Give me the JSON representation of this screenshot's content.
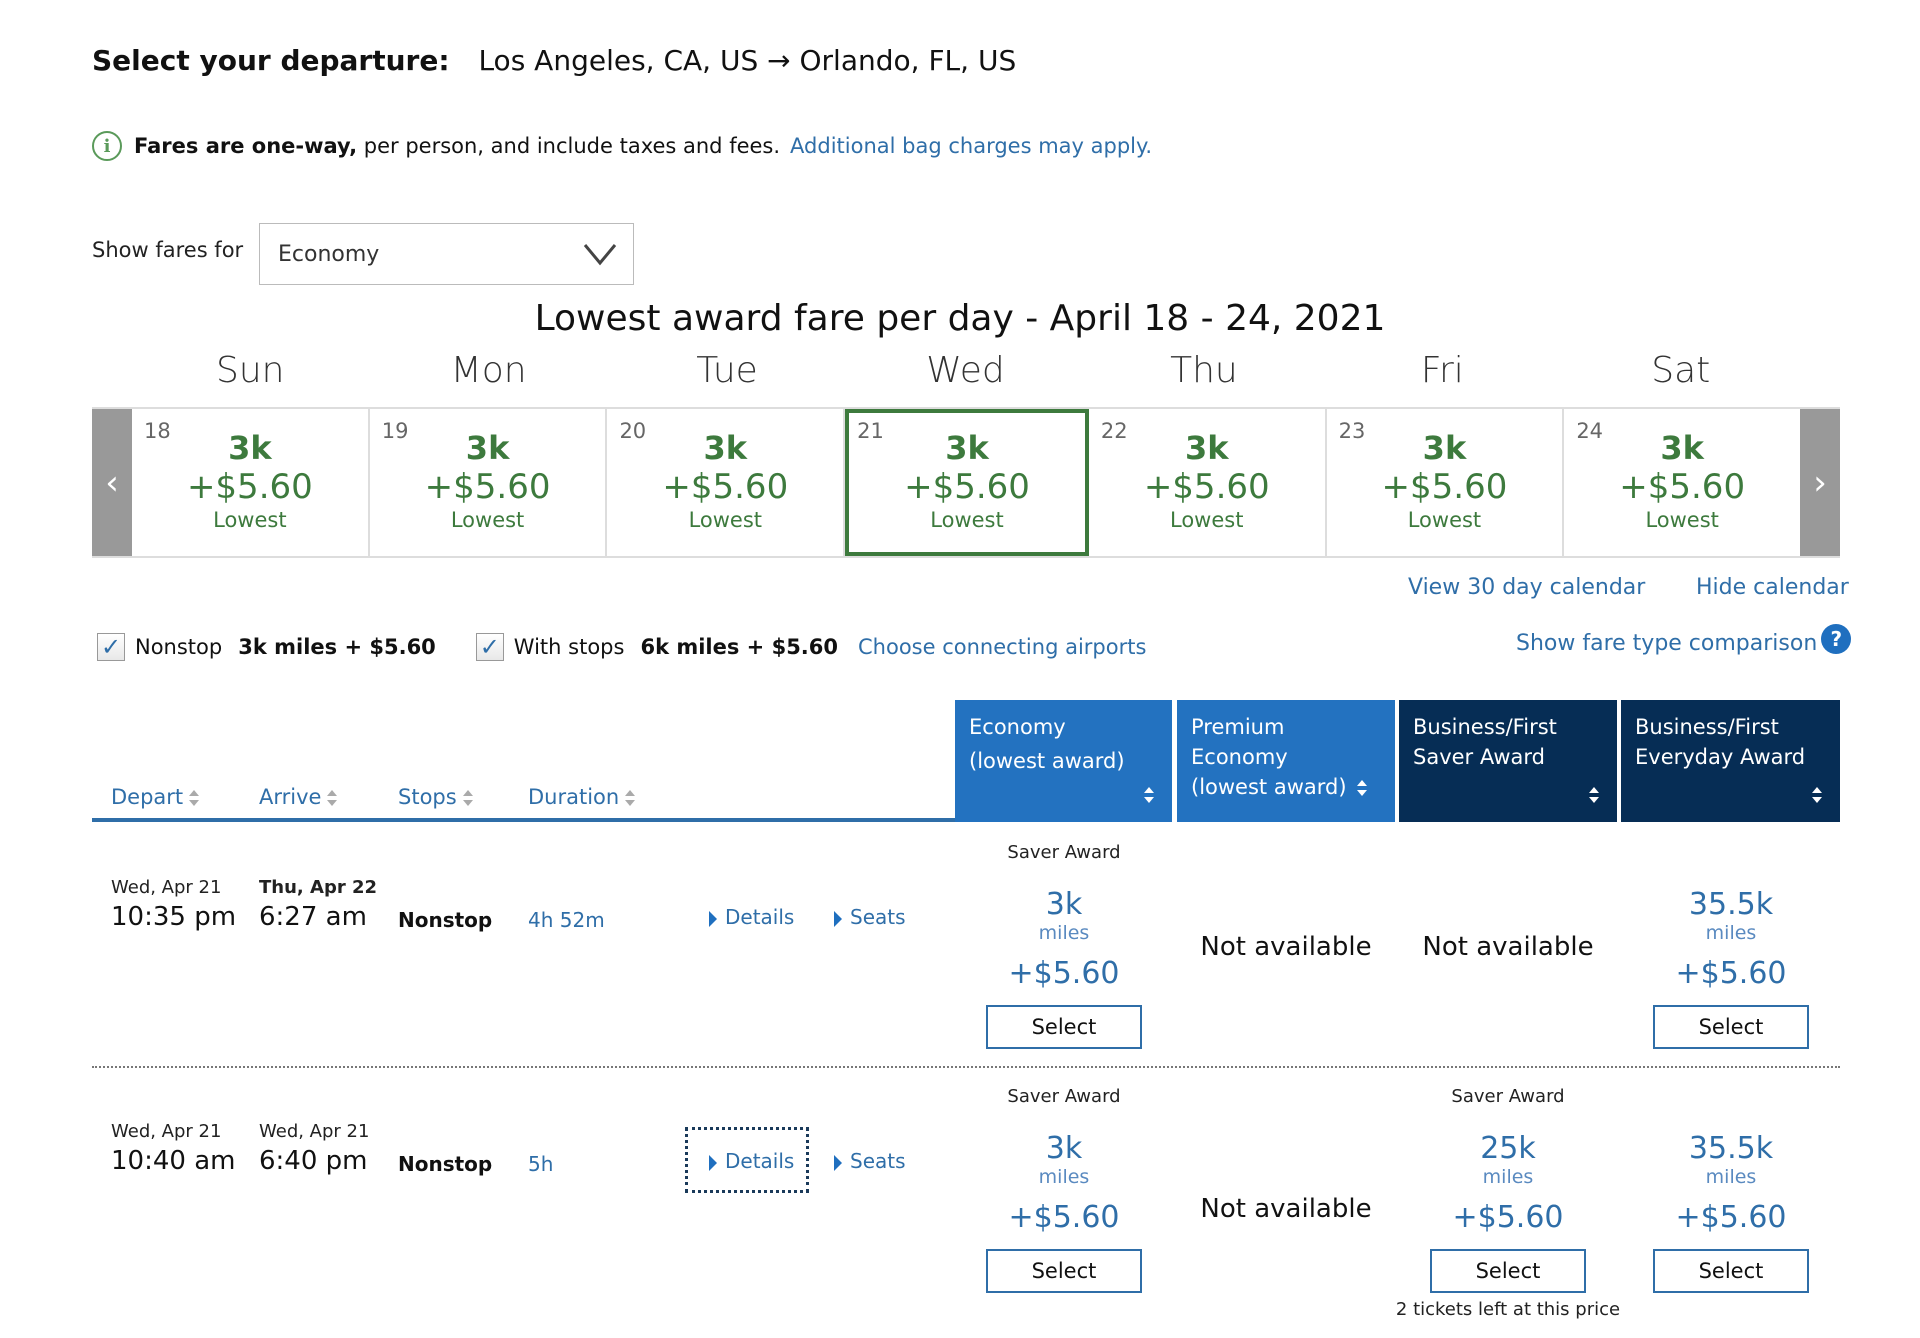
{
  "header": {
    "label": "Select your departure:",
    "route": "Los Angeles, CA, US → Orlando, FL, US"
  },
  "info": {
    "icon": "info-icon",
    "bold": "Fares are one-way,",
    "text": " per person, and include taxes and fees.",
    "link": "Additional bag charges may apply."
  },
  "fare_selector": {
    "label": "Show fares for",
    "value": "Economy"
  },
  "calendar": {
    "title": "Lowest award fare per day - April 18 - 24, 2021",
    "day_names": [
      "Sun",
      "Mon",
      "Tue",
      "Wed",
      "Thu",
      "Fri",
      "Sat"
    ],
    "days": [
      {
        "date": "18",
        "miles": "3k",
        "price": "+$5.60",
        "label": "Lowest",
        "selected": false
      },
      {
        "date": "19",
        "miles": "3k",
        "price": "+$5.60",
        "label": "Lowest",
        "selected": false
      },
      {
        "date": "20",
        "miles": "3k",
        "price": "+$5.60",
        "label": "Lowest",
        "selected": false
      },
      {
        "date": "21",
        "miles": "3k",
        "price": "+$5.60",
        "label": "Lowest",
        "selected": true
      },
      {
        "date": "22",
        "miles": "3k",
        "price": "+$5.60",
        "label": "Lowest",
        "selected": false
      },
      {
        "date": "23",
        "miles": "3k",
        "price": "+$5.60",
        "label": "Lowest",
        "selected": false
      },
      {
        "date": "24",
        "miles": "3k",
        "price": "+$5.60",
        "label": "Lowest",
        "selected": false
      }
    ],
    "prev_icon": "‹",
    "next_icon": "›",
    "view_30_day": "View 30 day calendar",
    "hide": "Hide calendar"
  },
  "filters": {
    "nonstop": {
      "label": "Nonstop",
      "value": "3k miles + $5.60",
      "checked": true
    },
    "with_stops": {
      "label": "With stops",
      "value": "6k miles + $5.60",
      "checked": true
    },
    "connecting_link": "Choose connecting airports",
    "compare_link": "Show fare type comparison",
    "help_icon": "?"
  },
  "table": {
    "sort_headers": [
      "Depart",
      "Arrive",
      "Stops",
      "Duration"
    ],
    "fare_headers": [
      {
        "line1": "Economy",
        "line2": "(lowest award)",
        "line3": ""
      },
      {
        "line1": "Premium",
        "line2": "Economy",
        "line3": "(lowest award)"
      },
      {
        "line1": "Business/First",
        "line2": "Saver Award",
        "line3": ""
      },
      {
        "line1": "Business/First",
        "line2": "Everyday Award",
        "line3": ""
      }
    ],
    "details_label": "Details",
    "seats_label": "Seats",
    "select_label": "Select",
    "miles_unit": "miles",
    "not_available": "Not available",
    "rows": [
      {
        "depart_date": "Wed, Apr 21",
        "depart_time": "10:35 pm",
        "arrive_date": "Thu, Apr 22",
        "arrive_time": "6:27 am",
        "stops": "Nonstop",
        "duration": "4h 52m",
        "fares": [
          {
            "tag": "Saver Award",
            "miles": "3k",
            "price": "+$5.60"
          },
          null,
          null,
          {
            "tag": "",
            "miles": "35.5k",
            "price": "+$5.60"
          }
        ]
      },
      {
        "depart_date": "Wed, Apr 21",
        "depart_time": "10:40 am",
        "arrive_date": "Wed, Apr 21",
        "arrive_time": "6:40 pm",
        "stops": "Nonstop",
        "duration": "5h",
        "fares": [
          {
            "tag": "Saver Award",
            "miles": "3k",
            "price": "+$5.60"
          },
          null,
          {
            "tag": "Saver Award",
            "miles": "25k",
            "price": "+$5.60",
            "note": "2 tickets left at this price"
          },
          {
            "tag": "",
            "miles": "35.5k",
            "price": "+$5.60"
          }
        ]
      }
    ]
  },
  "colors": {
    "calendar_green": "#3d7a3d",
    "link_blue": "#2f6ea8",
    "header_light_blue": "#2372c0",
    "header_dark_navy": "#062d55"
  }
}
